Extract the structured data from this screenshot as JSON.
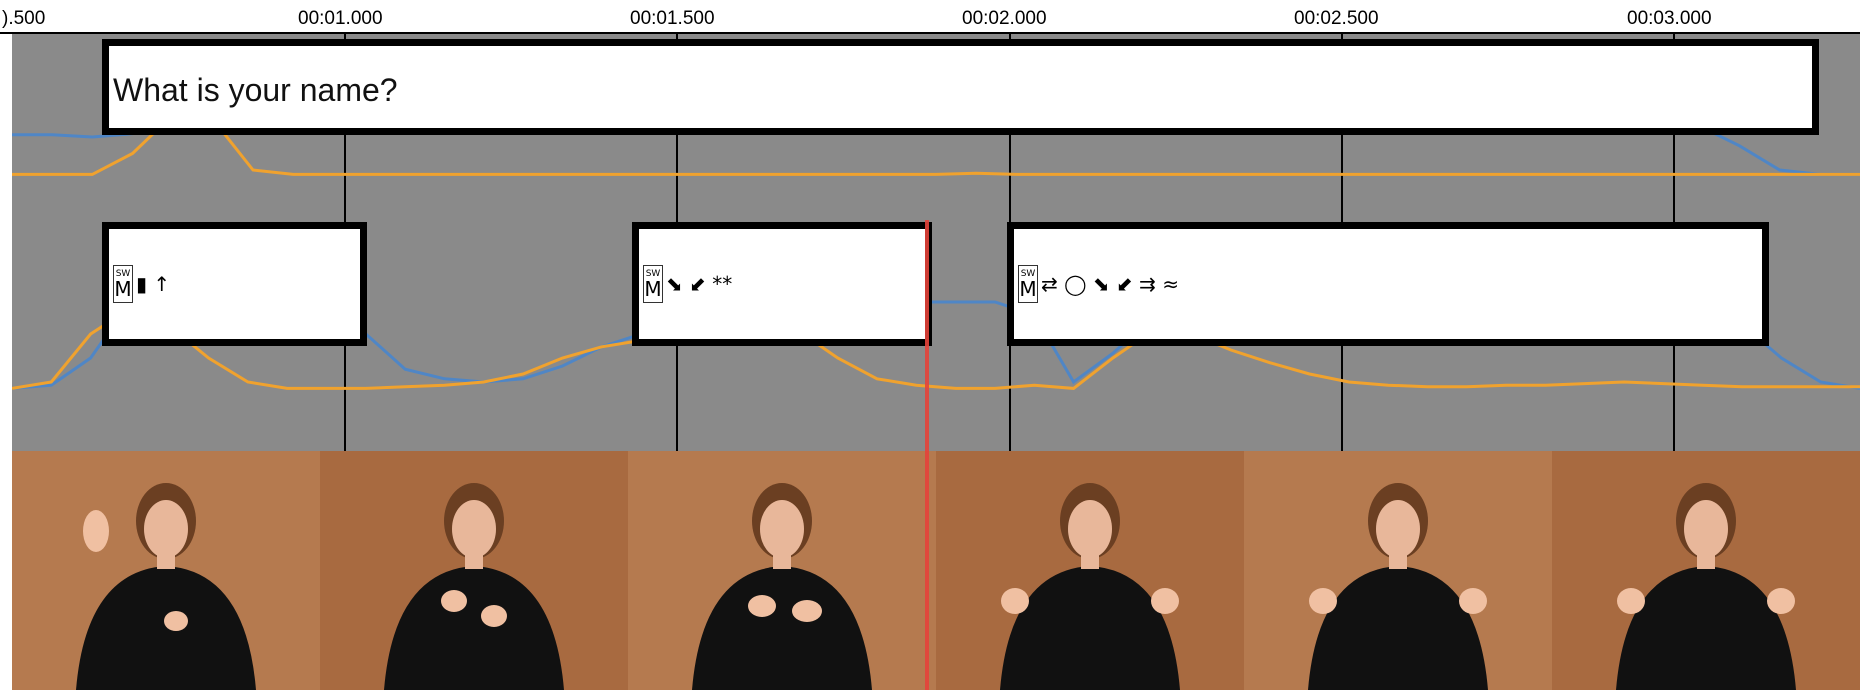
{
  "ruler": {
    "ticks": [
      {
        "label": ").500",
        "kind": "partial"
      },
      {
        "label": "00:01.000"
      },
      {
        "label": "00:01.500"
      },
      {
        "label": "00:02.000"
      },
      {
        "label": "00:02.500"
      },
      {
        "label": "00:03.000"
      }
    ]
  },
  "sentence_track": {
    "text": "What is your name?"
  },
  "sign_track": {
    "signs": [
      {
        "prefix": "SW",
        "letter": "M",
        "glyphs": "▮ ↑"
      },
      {
        "prefix": "SW",
        "letter": "M",
        "glyphs": "⬊ ⬋ **"
      },
      {
        "prefix": "SW",
        "letter": "M",
        "glyphs": "⇄ ◯ ⬊ ⬋ ⇉ ≈"
      }
    ]
  },
  "probability_curves": {
    "sentence": {
      "blue": [
        0.72,
        0.72,
        0.7,
        0.73,
        0.88,
        0.92,
        0.92,
        0.92,
        0.92,
        0.92,
        0.92,
        0.91,
        0.91,
        0.91,
        0.91,
        0.91,
        0.91,
        0.92,
        0.91,
        0.91,
        0.9,
        0.9,
        0.89,
        0.9,
        0.9,
        0.9,
        0.9,
        0.9,
        0.91,
        0.9,
        0.91,
        0.91,
        0.91,
        0.91,
        0.91,
        0.9,
        0.9,
        0.9,
        0.9,
        0.89,
        0.88,
        0.86,
        0.8,
        0.62,
        0.4,
        0.36,
        0.36
      ],
      "orange": [
        0.36,
        0.36,
        0.36,
        0.55,
        0.9,
        0.86,
        0.4,
        0.36,
        0.36,
        0.36,
        0.36,
        0.36,
        0.36,
        0.36,
        0.36,
        0.36,
        0.36,
        0.36,
        0.36,
        0.36,
        0.36,
        0.36,
        0.36,
        0.36,
        0.37,
        0.36,
        0.36,
        0.36,
        0.36,
        0.36,
        0.36,
        0.36,
        0.36,
        0.36,
        0.36,
        0.36,
        0.36,
        0.36,
        0.36,
        0.36,
        0.36,
        0.36,
        0.36,
        0.36,
        0.36,
        0.36,
        0.36
      ]
    },
    "sign": {
      "blue": [
        0.36,
        0.38,
        0.55,
        0.9,
        0.92,
        0.92,
        0.92,
        0.91,
        0.88,
        0.7,
        0.48,
        0.42,
        0.4,
        0.42,
        0.5,
        0.62,
        0.7,
        0.78,
        0.82,
        0.88,
        0.9,
        0.9,
        0.9,
        0.9,
        0.9,
        0.9,
        0.82,
        0.4,
        0.58,
        0.8,
        0.84,
        0.86,
        0.86,
        0.87,
        0.88,
        0.88,
        0.88,
        0.88,
        0.88,
        0.87,
        0.87,
        0.86,
        0.86,
        0.84,
        0.76,
        0.55,
        0.4,
        0.36
      ],
      "orange": [
        0.36,
        0.4,
        0.7,
        0.86,
        0.75,
        0.55,
        0.4,
        0.36,
        0.36,
        0.36,
        0.37,
        0.38,
        0.4,
        0.45,
        0.55,
        0.62,
        0.66,
        0.72,
        0.78,
        0.8,
        0.72,
        0.55,
        0.42,
        0.38,
        0.36,
        0.36,
        0.38,
        0.36,
        0.55,
        0.72,
        0.7,
        0.6,
        0.52,
        0.45,
        0.4,
        0.38,
        0.37,
        0.37,
        0.38,
        0.38,
        0.39,
        0.4,
        0.39,
        0.38,
        0.37,
        0.37,
        0.37,
        0.37
      ]
    }
  },
  "colors": {
    "blue_curve": "#4f86c6",
    "orange_curve": "#f0a22e",
    "track_bg": "#8a8a8a",
    "cursor": "#e4423a",
    "video_bg": "#b0744a"
  },
  "video_frames": [
    {
      "name": "video-frame-1",
      "pose": "open-palm"
    },
    {
      "name": "video-frame-2",
      "pose": "pointing"
    },
    {
      "name": "video-frame-3",
      "pose": "fingers-crossed"
    },
    {
      "name": "video-frame-4",
      "pose": "spread-hands"
    },
    {
      "name": "video-frame-5",
      "pose": "spread-hands"
    },
    {
      "name": "video-frame-6",
      "pose": "spread-hands"
    }
  ]
}
